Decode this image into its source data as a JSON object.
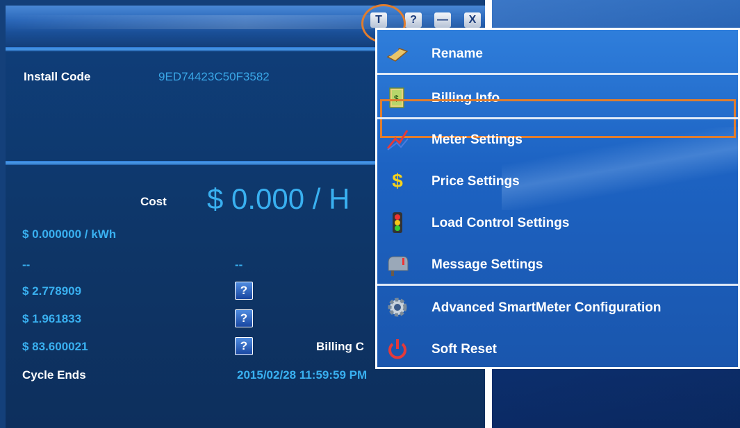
{
  "window": {
    "buttons": {
      "tools": "T",
      "help": "?",
      "minimize": "—",
      "close": "X"
    }
  },
  "device": {
    "install_code_label": "Install Code",
    "install_code_value": "9ED74423C50F3582"
  },
  "pricing": {
    "cost_label": "Cost",
    "cost_big": "$ 0.000 / H",
    "rate": "$ 0.000000 / kWh",
    "dash_left": "--",
    "dash_mid": "--",
    "row1_value": "$ 2.778909",
    "row2_value": "$ 1.961833",
    "row3_value": "$ 83.600021",
    "billing_partial_label": "Billing C",
    "cycle_ends_label": "Cycle Ends",
    "cycle_ends_value": "2015/02/28 11:59:59 PM",
    "help_glyph": "?"
  },
  "menu": {
    "items": [
      {
        "label": "Rename",
        "icon": "rename-icon"
      },
      {
        "label": "Billing Info",
        "icon": "billing-book-icon"
      },
      {
        "label": "Meter Settings",
        "icon": "chart-arrow-icon"
      },
      {
        "label": "Price Settings",
        "icon": "dollar-icon"
      },
      {
        "label": "Load Control Settings",
        "icon": "traffic-light-icon"
      },
      {
        "label": "Message Settings",
        "icon": "mailbox-icon"
      },
      {
        "label": "Advanced SmartMeter Configuration",
        "icon": "gear-icon"
      },
      {
        "label": "Soft Reset",
        "icon": "power-icon"
      }
    ],
    "highlighted": "Billing Info"
  },
  "colors": {
    "accent_value": "#39b0f0",
    "highlight_outline": "#e07d2e",
    "menu_bg": "#1d63c3"
  }
}
